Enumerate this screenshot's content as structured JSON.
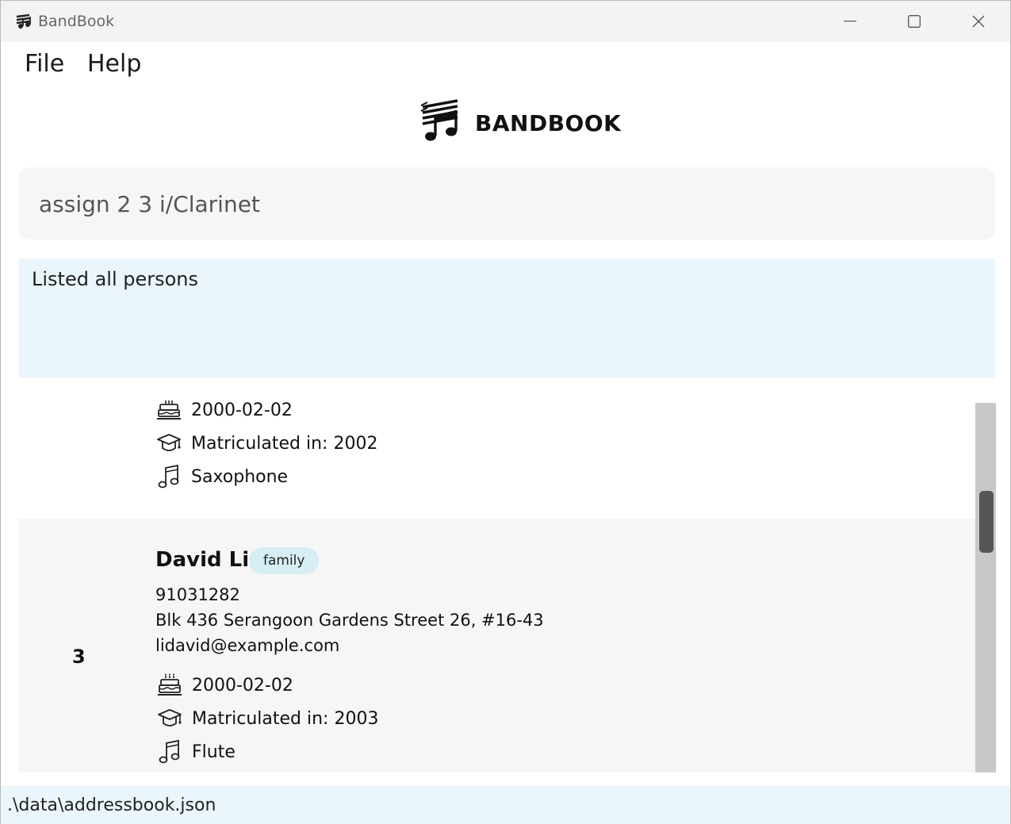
{
  "window": {
    "title": "BandBook",
    "app_icon": "bandbook-logo-icon",
    "controls": [
      "minimize-icon",
      "maximize-icon",
      "close-icon"
    ]
  },
  "menu": {
    "file": "File",
    "help": "Help"
  },
  "logo": {
    "text": "BANDBOOK",
    "icon": "music-notes-logo-icon"
  },
  "command": {
    "value": "assign 2 3 i/Clarinet"
  },
  "result": {
    "message": "Listed all persons"
  },
  "persons": [
    {
      "birthday": "2000-02-02",
      "matriculation": "Matriculated in: 2002",
      "instrument": "Saxophone"
    },
    {
      "index": "3",
      "name": "David Li",
      "tag": "family",
      "phone": "91031282",
      "address": "Blk 436 Serangoon Gardens Street 26, #16-43",
      "email": "lidavid@example.com",
      "birthday": "2000-02-02",
      "matriculation": "Matriculated in: 2003",
      "instrument": "Flute"
    }
  ],
  "status": {
    "path": ".\\data\\addressbook.json"
  },
  "icons": {
    "birthday": "cake-icon",
    "matriculation": "graduation-cap-icon",
    "instrument": "music-note-icon"
  },
  "colors": {
    "result_bg": "#ebf5fc",
    "tag_bg": "#d8eef5",
    "card_alt_bg": "#f6f6f6"
  }
}
